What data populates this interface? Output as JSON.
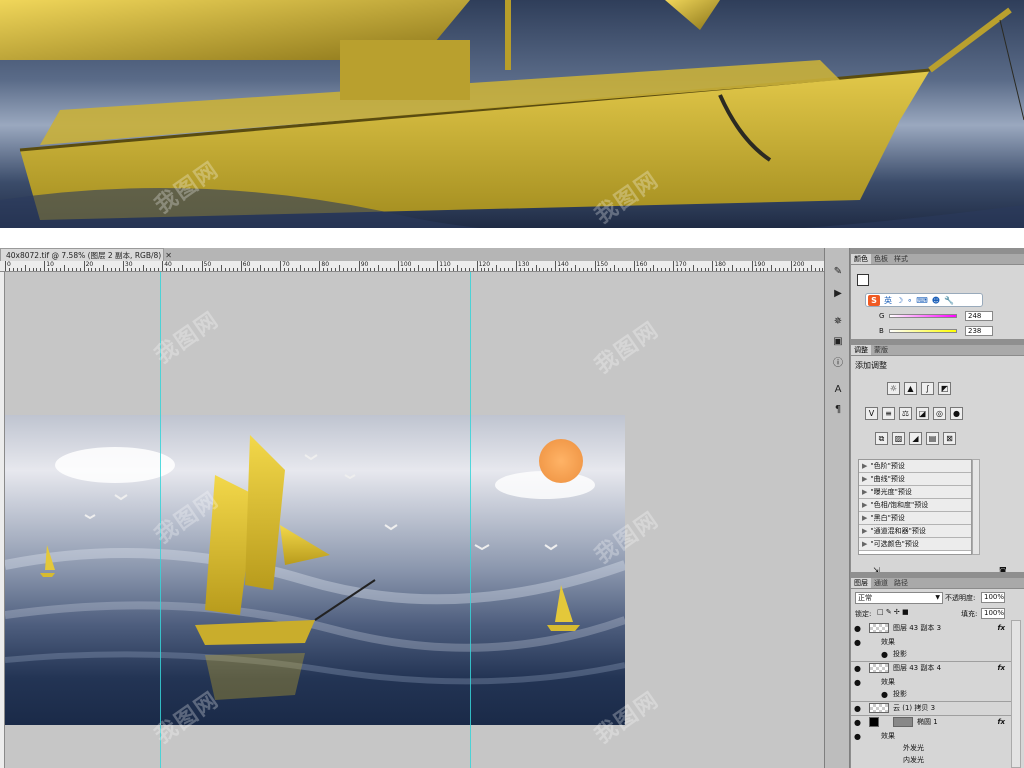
{
  "document": {
    "tab_title": "40x8072.tif @ 7.58% (图层 2 副本, RGB/8)",
    "close_glyph": "✕"
  },
  "ruler": {
    "labels": [
      "0",
      "10",
      "20",
      "30",
      "40",
      "50",
      "60",
      "70",
      "80",
      "90",
      "100",
      "110",
      "120",
      "130",
      "140",
      "150",
      "160",
      "170",
      "180",
      "190",
      "200"
    ]
  },
  "color_panel": {
    "tabs": [
      "颜色",
      "色板",
      "样式"
    ],
    "ime_logo": "S",
    "ime_items": [
      "英",
      "☽",
      "∘",
      "⌨",
      "☻",
      "🔧"
    ],
    "channels": [
      {
        "label": "G",
        "value": "248",
        "color": "#f0f"
      },
      {
        "label": "B",
        "value": "238",
        "color": "#ff0"
      }
    ]
  },
  "adjustments_panel": {
    "tabs": [
      "调整",
      "蒙版"
    ],
    "title": "添加调整",
    "presets": [
      "\"色阶\"预设",
      "\"曲线\"预设",
      "\"曝光度\"预设",
      "\"色相/饱和度\"预设",
      "\"黑白\"预设",
      "\"通道混和器\"预设",
      "\"可选颜色\"预设"
    ]
  },
  "layers_panel": {
    "tabs": [
      "图层",
      "通道",
      "路径"
    ],
    "blend_mode": "正常",
    "opacity_label": "不透明度:",
    "opacity_value": "100%",
    "lock_label": "锁定:",
    "fill_label": "填充:",
    "fill_value": "100%",
    "layers": [
      {
        "name": "图层 43 副本 3",
        "fx": "fx"
      },
      {
        "name": "效果"
      },
      {
        "name": "投影"
      },
      {
        "name": "图层 43 副本 4",
        "fx": "fx"
      },
      {
        "name": "效果"
      },
      {
        "name": "投影"
      },
      {
        "name": "云 (1) 拷贝 3"
      },
      {
        "name": "椭圆 1",
        "fx": "fx"
      },
      {
        "name": "效果"
      },
      {
        "name": "外发光"
      },
      {
        "name": "内发光"
      }
    ]
  },
  "icons": {
    "strip": [
      "brush-presets-icon",
      "play-icon",
      "compass-icon",
      "image-icon",
      "info-icon",
      "character-icon",
      "paragraph-icon"
    ]
  },
  "watermark": "我图网"
}
